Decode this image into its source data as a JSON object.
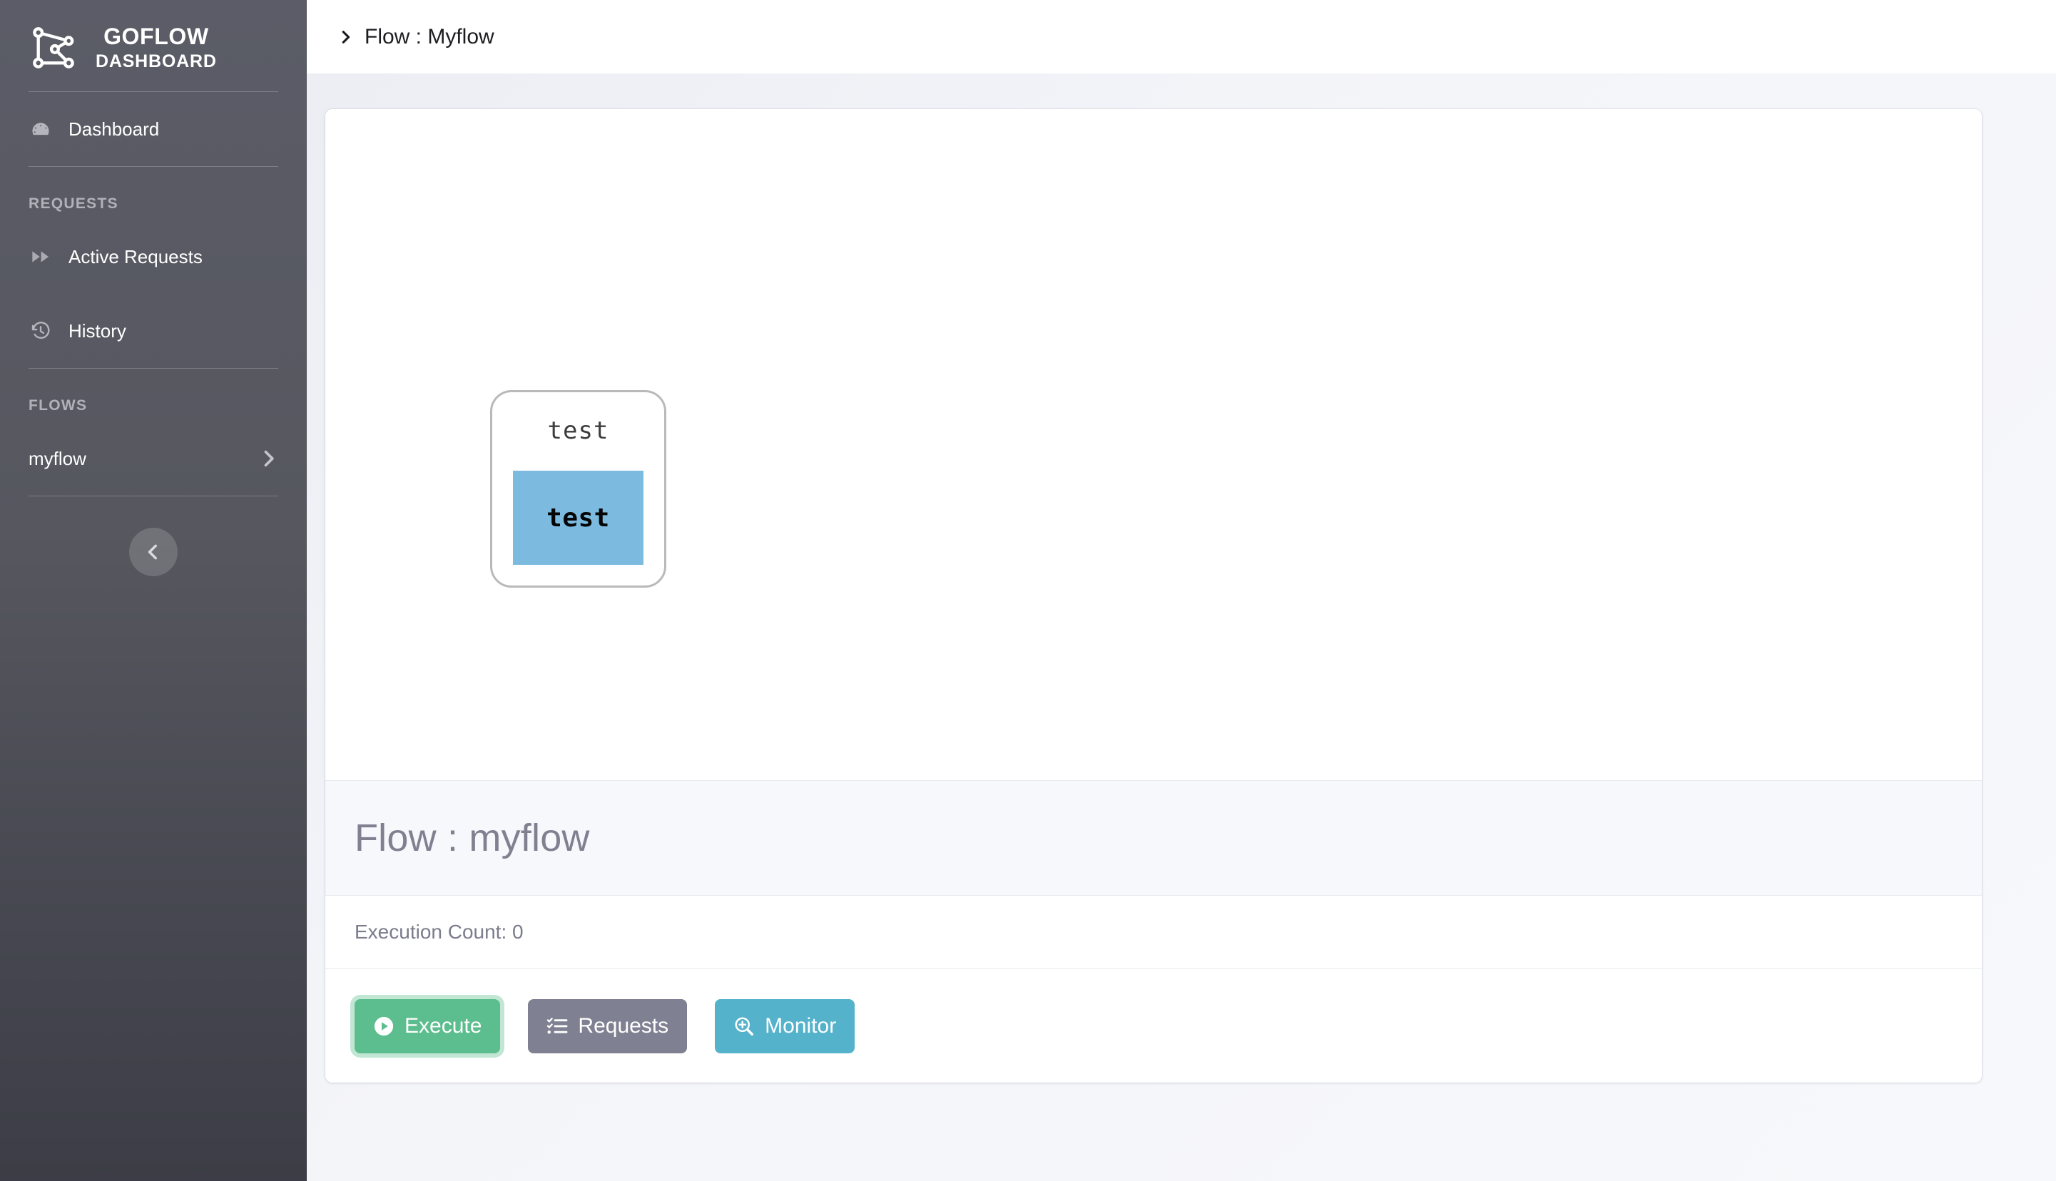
{
  "brand": {
    "logo_icon": "goflow-graph-logo-icon",
    "title": "GOFLOW",
    "subtitle": "DASHBOARD"
  },
  "sidebar": {
    "nav": [
      {
        "label": "Dashboard",
        "icon": "speedometer-icon"
      }
    ],
    "sections": [
      {
        "label": "REQUESTS",
        "items": [
          {
            "label": "Active Requests",
            "icon": "fast-forward-icon"
          },
          {
            "label": "History",
            "icon": "history-clock-icon"
          }
        ]
      },
      {
        "label": "FLOWS",
        "items": [
          {
            "label": "myflow",
            "icon": "chevron-right-icon"
          }
        ]
      }
    ],
    "collapse": {
      "icon": "chevron-left-icon"
    }
  },
  "topbar": {
    "caret_icon": "chevron-right-icon",
    "breadcrumb": "Flow : Myflow"
  },
  "canvas": {
    "node": {
      "title": "test",
      "box_label": "test",
      "box_color": "#7cbbdf",
      "border_color": "#b9b9bb"
    }
  },
  "detail": {
    "flow_title": "Flow : myflow",
    "execution_count": "Execution Count: 0",
    "buttons": [
      {
        "label": "Execute",
        "icon": "play-circle-icon",
        "color": "#5cbd8e",
        "focused": true
      },
      {
        "label": "Requests",
        "icon": "list-check-icon",
        "color": "#7f8091",
        "focused": false
      },
      {
        "label": "Monitor",
        "icon": "search-plus-icon",
        "color": "#55b2cb",
        "focused": false
      }
    ]
  }
}
